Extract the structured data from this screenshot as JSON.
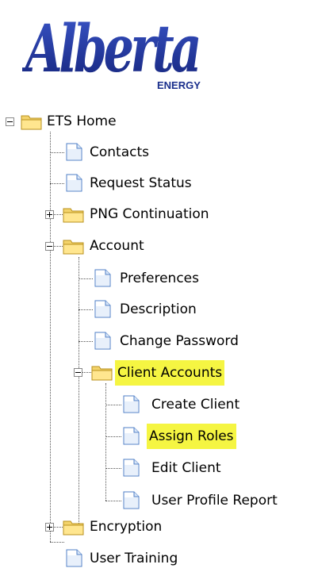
{
  "logo": {
    "word": "Alberta",
    "sub": "ENERGY"
  },
  "tree": {
    "root_label": "ETS Home",
    "contacts": "Contacts",
    "request_status": "Request Status",
    "png_continuation": "PNG Continuation",
    "account": "Account",
    "preferences": "Preferences",
    "description": "Description",
    "change_password": "Change Password",
    "client_accounts": "Client Accounts",
    "create_client": "Create Client",
    "assign_roles": "Assign Roles",
    "edit_client": "Edit Client",
    "user_profile_report": "User Profile Report",
    "encryption": "Encryption",
    "user_training": "User Training"
  },
  "colors": {
    "highlight": "#f5f542",
    "logo_blue": "#1a2f8c",
    "folder": "#f3d36b"
  }
}
